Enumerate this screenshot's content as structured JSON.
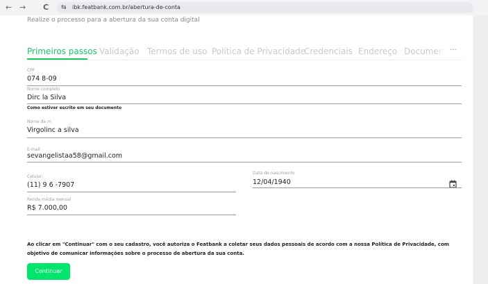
{
  "browser": {
    "back": "←",
    "forward": "→",
    "reload": "C",
    "site_icon": "⇆",
    "url": "ibk.featbank.com.br/abertura-de-conta"
  },
  "page": {
    "subtitle": "Realize o processo para a abertura da sua conta digital"
  },
  "tabs": {
    "items": [
      {
        "label": "Primeiros passos",
        "active": true
      },
      {
        "label": "Validação",
        "active": false
      },
      {
        "label": "Termos de uso",
        "active": false
      },
      {
        "label": "Política de Privacidade",
        "active": false
      },
      {
        "label": "Credenciais",
        "active": false
      },
      {
        "label": "Endereço",
        "active": false
      },
      {
        "label": "Documento",
        "active": false
      }
    ],
    "more": "···"
  },
  "form": {
    "cpf": {
      "label": "CPF",
      "value": "074          8-09"
    },
    "nome": {
      "label": "Nome completo",
      "value": "Dirc           la Silva",
      "helper": "Como estiver escrito em seu documento"
    },
    "mae": {
      "label": "Nome da m",
      "value": "Virgolinc          a silva"
    },
    "email": {
      "label": "E-mail",
      "value": "sevangelistaa58@gmail.com"
    },
    "celular": {
      "label": "Celular",
      "value": "(11) 9 6       -7907"
    },
    "nascimento": {
      "label": "Data de nascimento",
      "value": "12/04/1940"
    },
    "renda": {
      "label": "Renda média mensal",
      "value": "R$ 7.000,00"
    }
  },
  "consent": "Ao clicar em \"Continuar\" com o seu cadastro, você autoriza o Featbank a coletar seus dados pessoais de acordo com a nossa Política de Privacidade, com objetivo de comunicar informações sobre o processo de abertura da sua conta.",
  "buttons": {
    "continue": "Continuar"
  },
  "colors": {
    "accent": "#19c865",
    "button": "#00e56b"
  }
}
